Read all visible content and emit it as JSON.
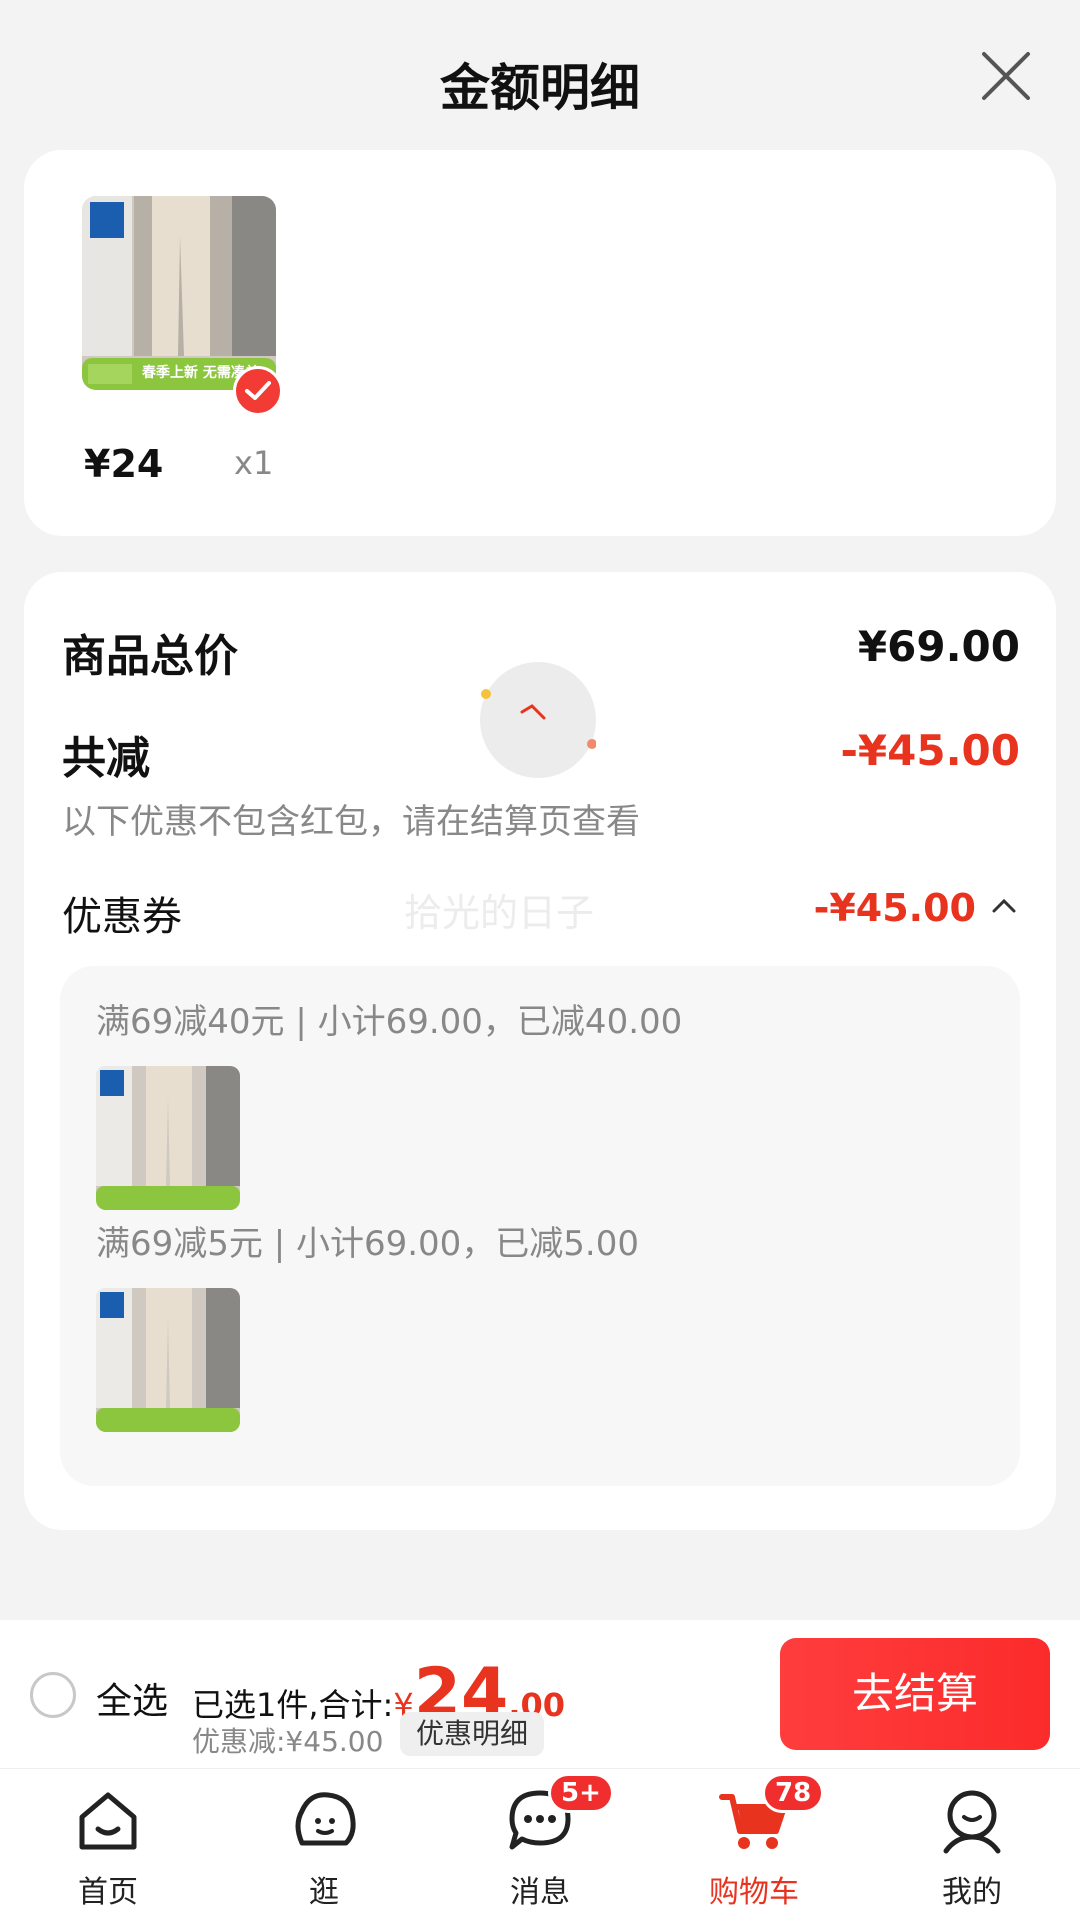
{
  "header": {
    "title": "金额明细"
  },
  "product": {
    "price": "¥24",
    "qty": "x1",
    "image_caption": "春季上新 无需凑单"
  },
  "summary": {
    "total_label": "商品总价",
    "total_value": "¥69.00",
    "reduce_label": "共减",
    "reduce_value": "-¥45.00",
    "notice": "以下优惠不包含红包，请在结算页查看",
    "coupon_label": "优惠券",
    "coupon_value": "-¥45.00",
    "watermark": "拾光的日子"
  },
  "coupon_details": [
    {
      "text": "满69减40元 | 小计69.00，已减40.00"
    },
    {
      "text": "满69减5元 | 小计69.00，已减5.00"
    }
  ],
  "bottom_bar": {
    "select_all": "全选",
    "selected_prefix": "已选1件,合计:",
    "currency": "¥",
    "amount_int": "24",
    "amount_dec": ".00",
    "discount": "优惠减:¥45.00",
    "detail_chip": "优惠明细",
    "checkout": "去结算"
  },
  "tabs": [
    {
      "label": "首页",
      "icon": "home-icon"
    },
    {
      "label": "逛",
      "icon": "stroll-icon"
    },
    {
      "label": "消息",
      "icon": "message-icon",
      "badge": "5+"
    },
    {
      "label": "购物车",
      "icon": "cart-icon",
      "badge": "78",
      "active": true
    },
    {
      "label": "我的",
      "icon": "profile-icon"
    }
  ],
  "colors": {
    "accent": "#e8331f",
    "button": "#fb2b2b",
    "background": "#f3f3f3"
  }
}
